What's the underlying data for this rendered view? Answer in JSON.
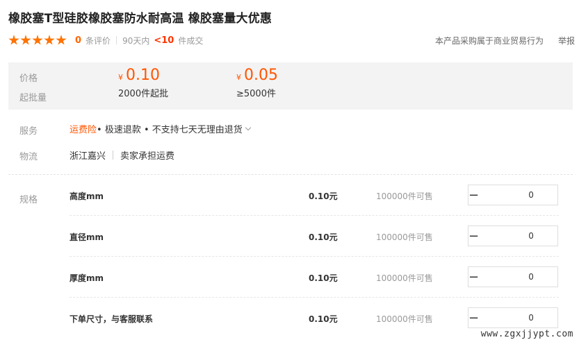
{
  "product": {
    "title": "橡胶塞T型硅胶橡胶塞防水耐高温 橡胶塞量大优惠"
  },
  "rating": {
    "stars": 5,
    "review_count": "0",
    "review_label": "条评价",
    "period": "90天内",
    "deal_count": "<10",
    "deal_label": "件成交",
    "purchase_notice": "本产品采购属于商业贸易行为",
    "report_label": "举报"
  },
  "price": {
    "price_label": "价格",
    "moq_label": "起批量",
    "currency": "¥",
    "tiers": [
      {
        "price": "0.10",
        "moq": "2000件起批"
      },
      {
        "price": "0.05",
        "moq": "≥5000件"
      }
    ]
  },
  "service": {
    "label": "服务",
    "insurance": "运费险",
    "rest": " • 极速退款 • 不支持七天无理由退货"
  },
  "logistics": {
    "label": "物流",
    "origin": "浙江嘉兴",
    "shipping": "卖家承担运费"
  },
  "specs": {
    "label": "规格",
    "items": [
      {
        "name": "高度mm",
        "price": "0.10元",
        "stock": "100000件可售",
        "qty": "0"
      },
      {
        "name": "直径mm",
        "price": "0.10元",
        "stock": "100000件可售",
        "qty": "0"
      },
      {
        "name": "厚度mm",
        "price": "0.10元",
        "stock": "100000件可售",
        "qty": "0"
      },
      {
        "name": "下单尺寸，与客服联系",
        "price": "0.10元",
        "stock": "100000件可售",
        "qty": "0"
      }
    ]
  },
  "watermark": "www.zgxjjypt.com",
  "colors": {
    "accent": "#ff5500",
    "star": "#ff7300",
    "deal_count": "#ff3300"
  }
}
